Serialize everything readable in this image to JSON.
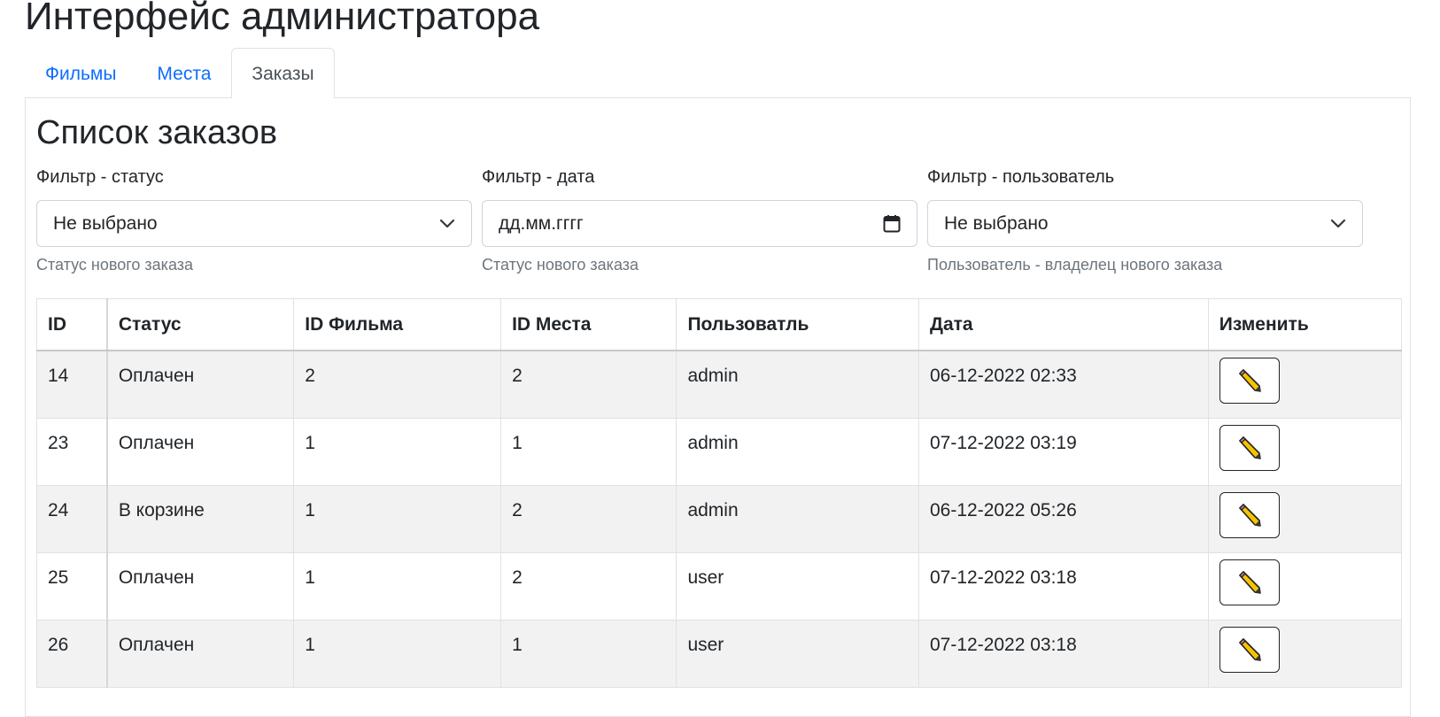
{
  "header": {
    "title": "Интерфейс администратора"
  },
  "tabs": [
    {
      "label": "Фильмы",
      "active": false
    },
    {
      "label": "Места",
      "active": false
    },
    {
      "label": "Заказы",
      "active": true
    }
  ],
  "section": {
    "title": "Список заказов"
  },
  "filters": {
    "status": {
      "label": "Фильтр - статус",
      "value": "Не выбрано",
      "help": "Статус нового заказа"
    },
    "date": {
      "label": "Фильтр - дата",
      "placeholder": "дд.мм.гггг",
      "help": "Статус нового заказа"
    },
    "user": {
      "label": "Фильтр - пользователь",
      "value": "Не выбрано",
      "help": "Пользователь - владелец нового заказа"
    }
  },
  "table": {
    "headers": [
      "ID",
      "Статус",
      "ID Фильма",
      "ID Места",
      "Пользоватль",
      "Дата",
      "Изменить"
    ],
    "rows": [
      {
        "id": "14",
        "status": "Оплачен",
        "film_id": "2",
        "seat_id": "2",
        "user": "admin",
        "date": "06-12-2022 02:33"
      },
      {
        "id": "23",
        "status": "Оплачен",
        "film_id": "1",
        "seat_id": "1",
        "user": "admin",
        "date": "07-12-2022 03:19"
      },
      {
        "id": "24",
        "status": "В корзине",
        "film_id": "1",
        "seat_id": "2",
        "user": "admin",
        "date": "06-12-2022 05:26"
      },
      {
        "id": "25",
        "status": "Оплачен",
        "film_id": "1",
        "seat_id": "2",
        "user": "user",
        "date": "07-12-2022 03:18"
      },
      {
        "id": "26",
        "status": "Оплачен",
        "film_id": "1",
        "seat_id": "1",
        "user": "user",
        "date": "07-12-2022 03:18"
      }
    ],
    "edit_icon": "pencil-icon"
  },
  "colors": {
    "link": "#0d6efd",
    "stripe": "#f2f2f2",
    "border": "#dee2e6",
    "muted": "#6c757d"
  }
}
